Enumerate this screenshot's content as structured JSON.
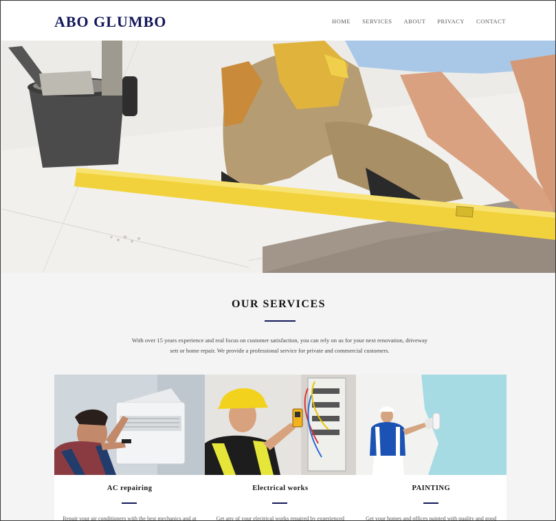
{
  "site": {
    "logo": "ABO GLUMBO"
  },
  "nav": {
    "items": [
      "HOME",
      "SERVICES",
      "ABOUT",
      "PRIVACY",
      "CONTACT"
    ]
  },
  "hero": {
    "image": "tiler-with-spirit-level-photo"
  },
  "services": {
    "title": "OUR SERVICES",
    "intro": "With over 15 years experience and real focus on customer satisfaction, you can rely on us for your next renovation, driveway sett or home repair. We provide a professional service for private and commercial customers.",
    "cards": [
      {
        "title": "AC repairing",
        "description": "Repair your air conditioners with the best mechanics and at",
        "image": "ac-technician-photo"
      },
      {
        "title": "Electrical works",
        "description": "Get any of your electrical works repaired by experienced",
        "image": "electrician-photo"
      },
      {
        "title": "PAINTING",
        "description": "Get your homes and offices painted with quality and good",
        "image": "painter-photo"
      }
    ]
  },
  "colors": {
    "brand": "#14175a",
    "page_bg": "#f4f4f4",
    "accent_yellow": "#f2d23c"
  }
}
